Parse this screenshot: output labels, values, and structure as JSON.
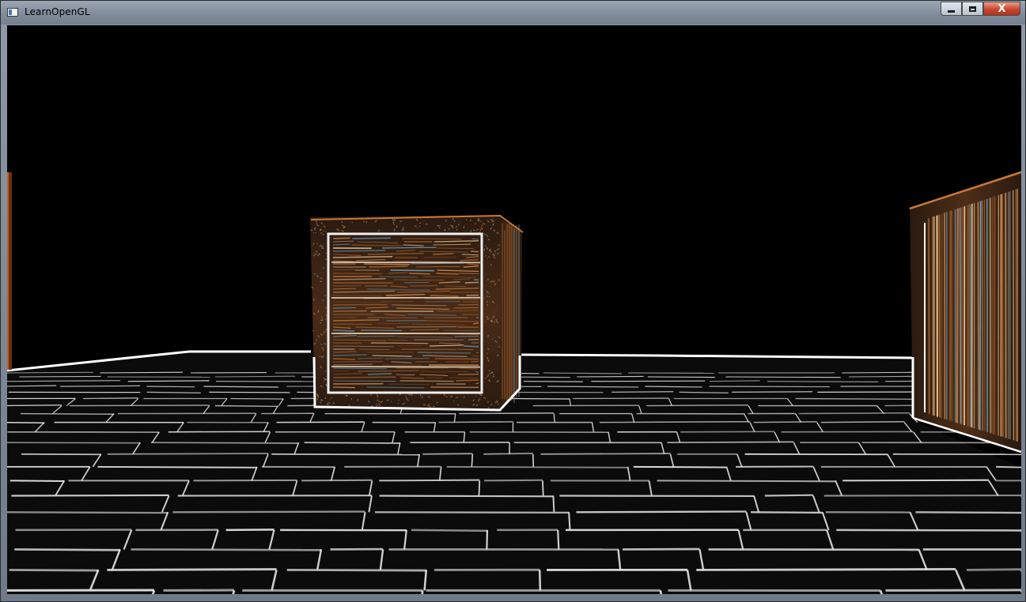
{
  "window": {
    "title": "LearnOpenGL",
    "controls": {
      "minimize_icon": "minimize-icon",
      "maximize_icon": "maximize-icon",
      "close_icon": "close-icon",
      "close_glyph": "X"
    }
  },
  "scene": {
    "description_icon": "opengl-render-canvas",
    "colors": {
      "background": "#000000",
      "edge_white": "#ffffff",
      "wood_orange": "#c87838",
      "wood_dark": "#3a2418",
      "accent_blue": "#6fa8c8"
    }
  }
}
